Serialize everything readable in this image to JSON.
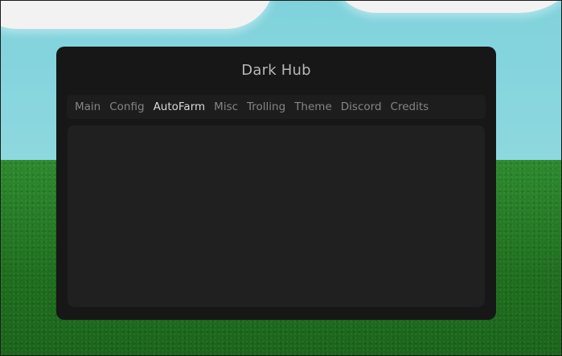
{
  "window": {
    "title": "Dark Hub"
  },
  "tabs": [
    {
      "label": "Main"
    },
    {
      "label": "Config"
    },
    {
      "label": "AutoFarm"
    },
    {
      "label": "Misc"
    },
    {
      "label": "Trolling"
    },
    {
      "label": "Theme"
    },
    {
      "label": "Discord"
    },
    {
      "label": "Credits"
    }
  ],
  "active_tab": "AutoFarm",
  "colors": {
    "window_bg": "#171717",
    "panel_bg": "#202020",
    "tab_active": "#d9d9d9",
    "tab_inactive": "#858585"
  }
}
